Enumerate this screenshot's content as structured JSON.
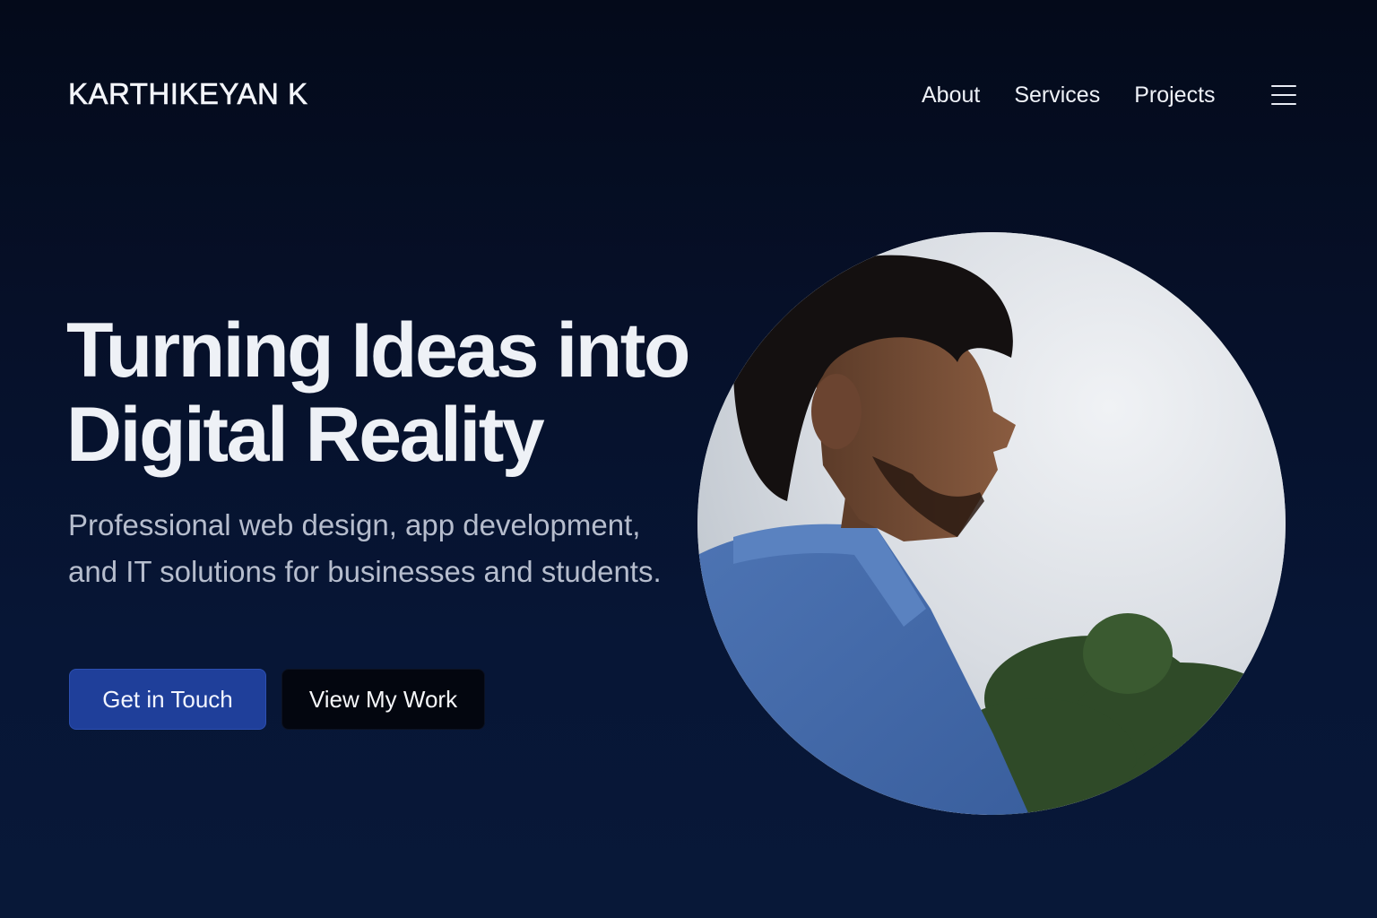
{
  "brand": {
    "name": "KARTHIKEYAN K"
  },
  "nav": {
    "items": [
      {
        "label": "About"
      },
      {
        "label": "Services"
      },
      {
        "label": "Projects"
      }
    ],
    "menu_icon": "hamburger-menu-icon"
  },
  "hero": {
    "headline_line1": "Turning Ideas into",
    "headline_line2": "Digital Reality",
    "subtitle": "Professional web design, app development, and IT solutions for businesses and students.",
    "primary_button": "Get in Touch",
    "secondary_button": "View My Work"
  },
  "colors": {
    "background": "#061029",
    "primary_button": "#1f3f9a",
    "secondary_button": "#03060f",
    "text_primary": "#eef1f6",
    "text_muted": "#b6bdcd"
  }
}
